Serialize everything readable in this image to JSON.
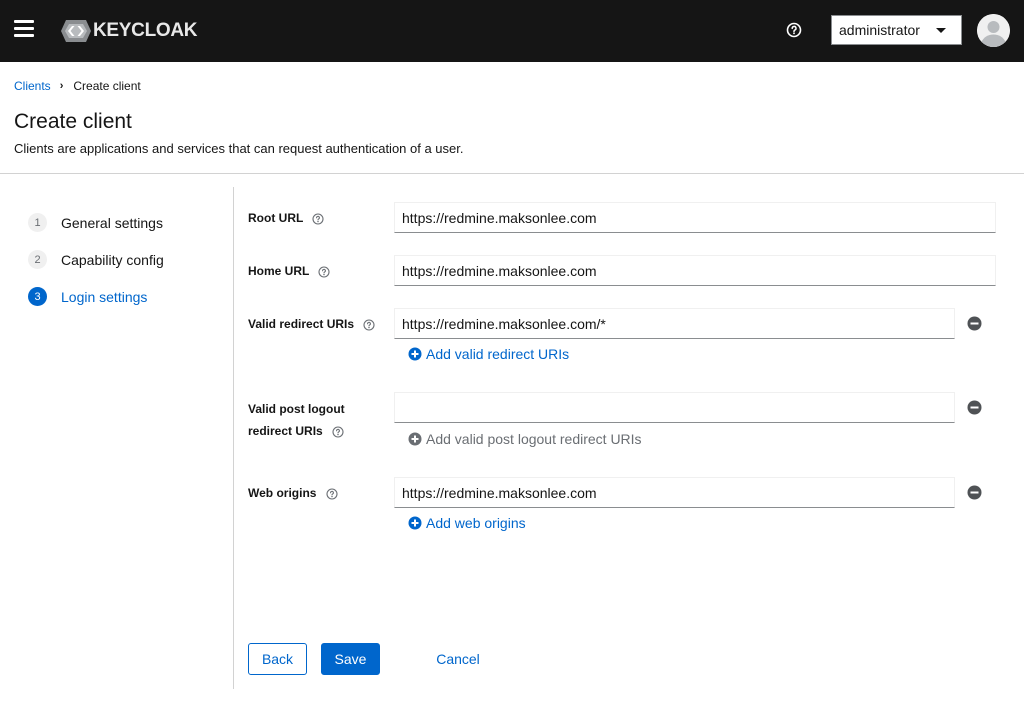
{
  "header": {
    "logo_text": "KEYCLOAK",
    "user_name": "administrator",
    "icons": [
      "hamburger-menu-icon",
      "keycloak-logo-icon",
      "help-icon",
      "caret-down-icon",
      "avatar-icon"
    ]
  },
  "breadcrumb": {
    "parent": "Clients",
    "separator": "›",
    "current": "Create client"
  },
  "page": {
    "title": "Create client",
    "description": "Clients are applications and services that can request authentication of a user."
  },
  "wizard": {
    "steps": [
      {
        "number": "1",
        "label": "General settings"
      },
      {
        "number": "2",
        "label": "Capability config"
      },
      {
        "number": "3",
        "label": "Login settings"
      }
    ],
    "active_step": "3"
  },
  "form": {
    "root_url": {
      "label": "Root URL",
      "value": "https://redmine.maksonlee.com"
    },
    "home_url": {
      "label": "Home URL",
      "value": "https://redmine.maksonlee.com"
    },
    "valid_redirect": {
      "label": "Valid redirect URIs",
      "value": "https://redmine.maksonlee.com/*",
      "add_label": "Add valid redirect URIs"
    },
    "post_logout": {
      "label_line1": "Valid post logout",
      "label_line2": "redirect URIs",
      "value": "",
      "add_label": "Add valid post logout redirect URIs"
    },
    "web_origins": {
      "label": "Web origins",
      "value": "https://redmine.maksonlee.com",
      "add_label": "Add web origins"
    }
  },
  "actions": {
    "back": "Back",
    "save": "Save",
    "cancel": "Cancel"
  },
  "colors": {
    "masthead": "#151515",
    "primary": "#0066cc",
    "disabled": "#6a6e73",
    "border": "#8a8d90"
  }
}
